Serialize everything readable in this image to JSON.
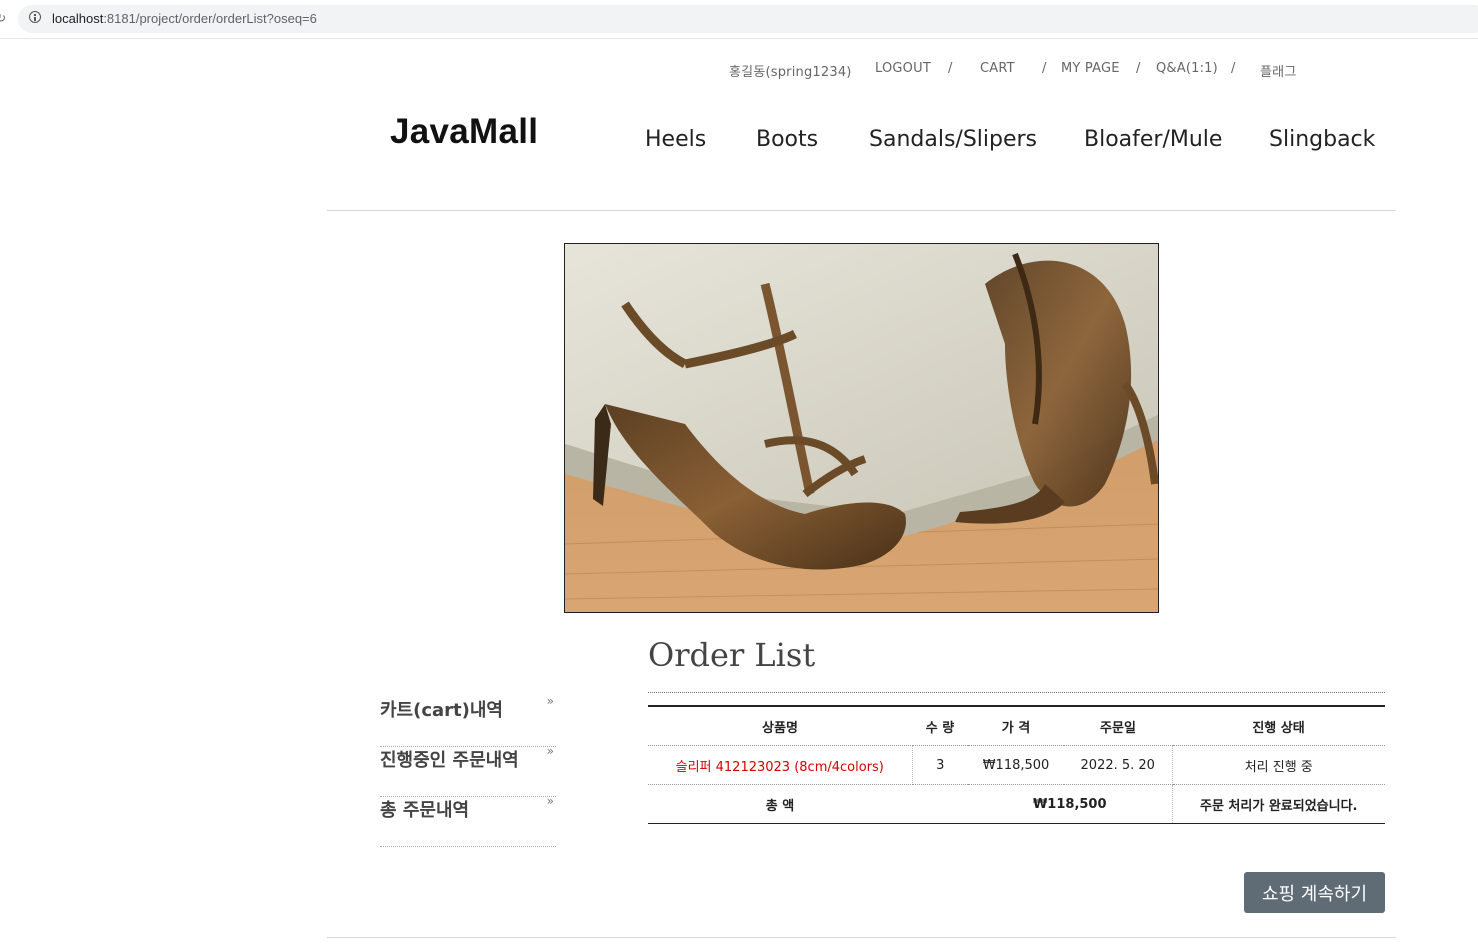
{
  "browser": {
    "url_host": "localhost",
    "url_path": ":8181/project/order/orderList?oseq=6"
  },
  "util_nav": {
    "user": "홍길동(spring1234)",
    "logout": "LOGOUT",
    "cart": "CART",
    "mypage": "MY PAGE",
    "qna": "Q&A(1:1)",
    "extra": "플래그",
    "separator": "/"
  },
  "logo": "JavaMall",
  "main_nav": [
    "Heels",
    "Boots",
    "Sandals/Slipers",
    "Bloafer/Mule",
    "Slingback"
  ],
  "sidebar": {
    "items": [
      {
        "label": "카트(cart)내역",
        "arrow": "»"
      },
      {
        "label": "진행중인 주문내역",
        "arrow": "»"
      },
      {
        "label": "총 주문내역",
        "arrow": "»"
      }
    ]
  },
  "order_list": {
    "title": "Order List",
    "headers": [
      "상품명",
      "수 량",
      "가 격",
      "주문일",
      "진행 상태"
    ],
    "rows": [
      {
        "product": "슬리퍼 412123023 (8cm/4colors)",
        "qty": "3",
        "price": "₩118,500",
        "date": "2022. 5. 20",
        "status": "처리 진행 중"
      }
    ],
    "total": {
      "label": "총 액",
      "amount": "₩118,500",
      "message": "주문 처리가 완료되었습니다."
    }
  },
  "continue_button": "쇼핑 계속하기",
  "colors": {
    "product_link": "#d40000",
    "button_bg": "#5f6b75"
  }
}
